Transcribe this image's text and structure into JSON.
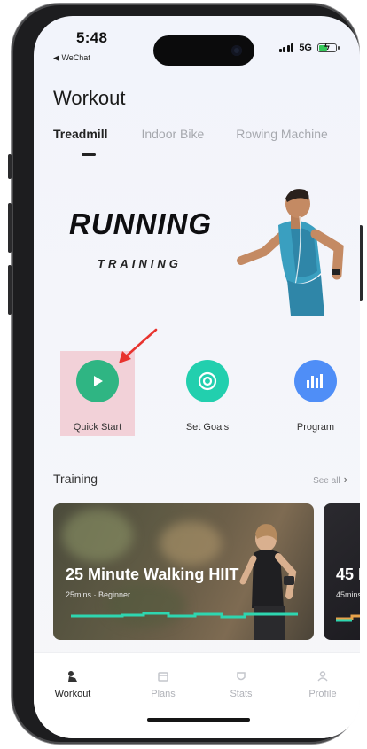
{
  "status_bar": {
    "time": "5:48",
    "back_app": "WeChat",
    "network": "5G"
  },
  "header": {
    "title": "Workout"
  },
  "tabs": [
    {
      "label": "Treadmill",
      "active": true
    },
    {
      "label": "Indoor Bike",
      "active": false
    },
    {
      "label": "Rowing Machine",
      "active": false
    }
  ],
  "banner": {
    "title": "RUNNING",
    "subtitle": "TRAINING"
  },
  "actions": [
    {
      "label": "Quick Start",
      "icon": "play-icon",
      "color": "#2fb583"
    },
    {
      "label": "Set Goals",
      "icon": "target-icon",
      "color": "#22cfae"
    },
    {
      "label": "Program",
      "icon": "program-icon",
      "color": "#4f8ef7"
    }
  ],
  "training": {
    "title": "Training",
    "see_all": "See all",
    "cards": [
      {
        "title": "25 Minute Walking HIIT",
        "duration": "25mins",
        "level": "Beginner"
      },
      {
        "title": "45 I",
        "duration": "45mins",
        "level": ""
      }
    ]
  },
  "bottom_nav": [
    {
      "label": "Workout",
      "icon": "workout-icon",
      "active": true
    },
    {
      "label": "Plans",
      "icon": "plans-icon",
      "active": false
    },
    {
      "label": "Stats",
      "icon": "stats-icon",
      "active": false
    },
    {
      "label": "Profile",
      "icon": "profile-icon",
      "active": false
    }
  ],
  "colors": {
    "highlight": "#f096a0",
    "accent_green": "#2fb583",
    "arrow_red": "#e8332e"
  }
}
